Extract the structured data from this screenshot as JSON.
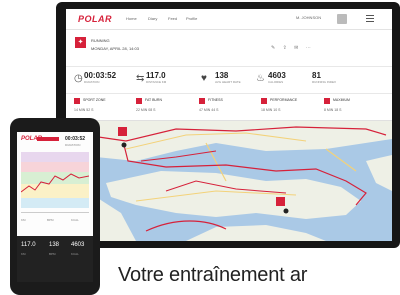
{
  "caption": "Votre entraînement ar",
  "app": {
    "brand": "POLAR",
    "nav_items": [
      "Home",
      "Diary",
      "Feed",
      "Profile"
    ],
    "nav_right": "M. JOHNSON"
  },
  "session": {
    "title": "RUNNING",
    "date": "MONDAY, APRIL 28, 14:03"
  },
  "stats": [
    {
      "icon": "clock-icon",
      "value": "00:03:52",
      "label": "DURATION"
    },
    {
      "icon": "distance-icon",
      "value": "117.0",
      "label": "DISTANCE KM"
    },
    {
      "icon": "heart-icon",
      "value": "138",
      "label": "AVG HEART RATE"
    },
    {
      "icon": "fire-icon",
      "value": "4603",
      "label": "CALORIES"
    },
    {
      "icon": "index-icon",
      "value": "81",
      "label": "RUNNING INDEX"
    }
  ],
  "zones": [
    {
      "name": "SPORT ZONE",
      "sub": "14 MIN 52 S"
    },
    {
      "name": "FAT BURN",
      "sub": "22 MIN 08 S"
    },
    {
      "name": "FITNESS",
      "sub": "47 MIN 44 S"
    },
    {
      "name": "PERFORMANCE",
      "sub": "18 MIN 10 S"
    },
    {
      "name": "MAXIMUM",
      "sub": "8 MIN 18 S"
    }
  ],
  "phone": {
    "brand": "POLAR",
    "value_main": "00:03:52",
    "label_main": "DURATION",
    "values": [
      "117.0",
      "138",
      "4603"
    ],
    "labels": [
      "KM",
      "BPM",
      "KCAL"
    ]
  },
  "colors": {
    "accent": "#d6213a",
    "water": "#aac9e6",
    "land": "#eef0e6",
    "route": "#d6213a"
  }
}
